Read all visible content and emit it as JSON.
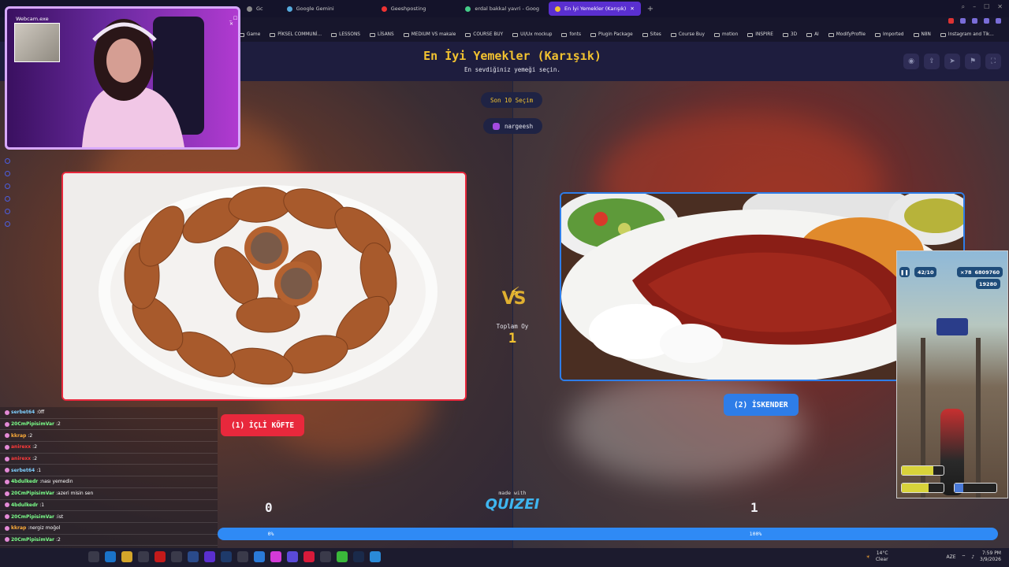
{
  "browser": {
    "tabs": [
      {
        "label": "Gc"
      },
      {
        "label": "Google Gemini"
      },
      {
        "label": "Geeshposting"
      },
      {
        "label": "erdal bakkal yavri - Goog"
      },
      {
        "label": "En İyi Yemekler (Karışık)"
      }
    ],
    "bookmarks": [
      "Game",
      "PİKSEL COMMUNİ...",
      "LESSONS",
      "LİSANS",
      "MEDIUM VS makale",
      "COURSE BUY",
      "UI/Ux mockup",
      "fonts",
      "Plugin Package",
      "Sites",
      "Course Buy",
      "motion",
      "INSPIRE",
      "3D",
      "AI",
      "ModifyProfile",
      "Imported",
      "N8N",
      "Instagram and Tik..."
    ]
  },
  "webcam": {
    "title": "Webcam.exe",
    "controls": "_ ☐ ✕"
  },
  "quiz": {
    "title": "En İyi Yemekler (Karışık)",
    "subtitle": "En sevdiğiniz yemeği seçin.",
    "history_pill": "Son 10 Seçim",
    "user": "nargeesh",
    "vs": "VS",
    "total_label": "Toplam Oy",
    "total_votes": "1",
    "left_choice": "(1) İÇLİ KÖFTE",
    "right_choice": "(2) İSKENDER",
    "left_count": "0",
    "right_count": "1",
    "left_percent": "0%",
    "right_percent": "100%",
    "left_fraction": 0.0,
    "made_with": "made with",
    "brand": "QUIZEI"
  },
  "chat": [
    {
      "user": "serbet64",
      "msg": "0ff",
      "color": "#7fd0ff"
    },
    {
      "user": "20CmPipisimVar",
      "msg": "2",
      "color": "#7bff8a"
    },
    {
      "user": "kkrap",
      "msg": "2",
      "color": "#ffae3a"
    },
    {
      "user": "anirexx",
      "msg": "2",
      "color": "#ff3a3a"
    },
    {
      "user": "anirexx",
      "msg": "2",
      "color": "#ff3a3a"
    },
    {
      "user": "serbet64",
      "msg": "1",
      "color": "#7fd0ff"
    },
    {
      "user": "4bdulkedr",
      "msg": "nası yemedin",
      "color": "#7bff8a"
    },
    {
      "user": "20CmPipisimVar",
      "msg": "azeri misin sen",
      "color": "#7bff8a"
    },
    {
      "user": "4bdulkedr",
      "msg": "1",
      "color": "#7bff8a"
    },
    {
      "user": "20CmPipisimVar",
      "msg": "ist",
      "color": "#7bff8a"
    },
    {
      "user": "kkrap",
      "msg": "nergiz moğol",
      "color": "#ffae3a"
    },
    {
      "user": "20CmPipisimVar",
      "msg": "2",
      "color": "#7bff8a"
    },
    {
      "user": "",
      "msg": "ist ne ~ ya",
      "color": "#ffffff"
    }
  ],
  "game": {
    "stat_keys": "42/10",
    "multiplier": "×78",
    "coins": "6809760",
    "score": "19280"
  },
  "taskbar": {
    "weather": "14°C",
    "weather_desc": "Clear",
    "lang": "AZE",
    "time": "7:59 PM",
    "date": "3/9/2026"
  },
  "colors": {
    "accent_red": "#e8283c",
    "accent_blue": "#2e7de8",
    "title_gold": "#f2c230"
  }
}
